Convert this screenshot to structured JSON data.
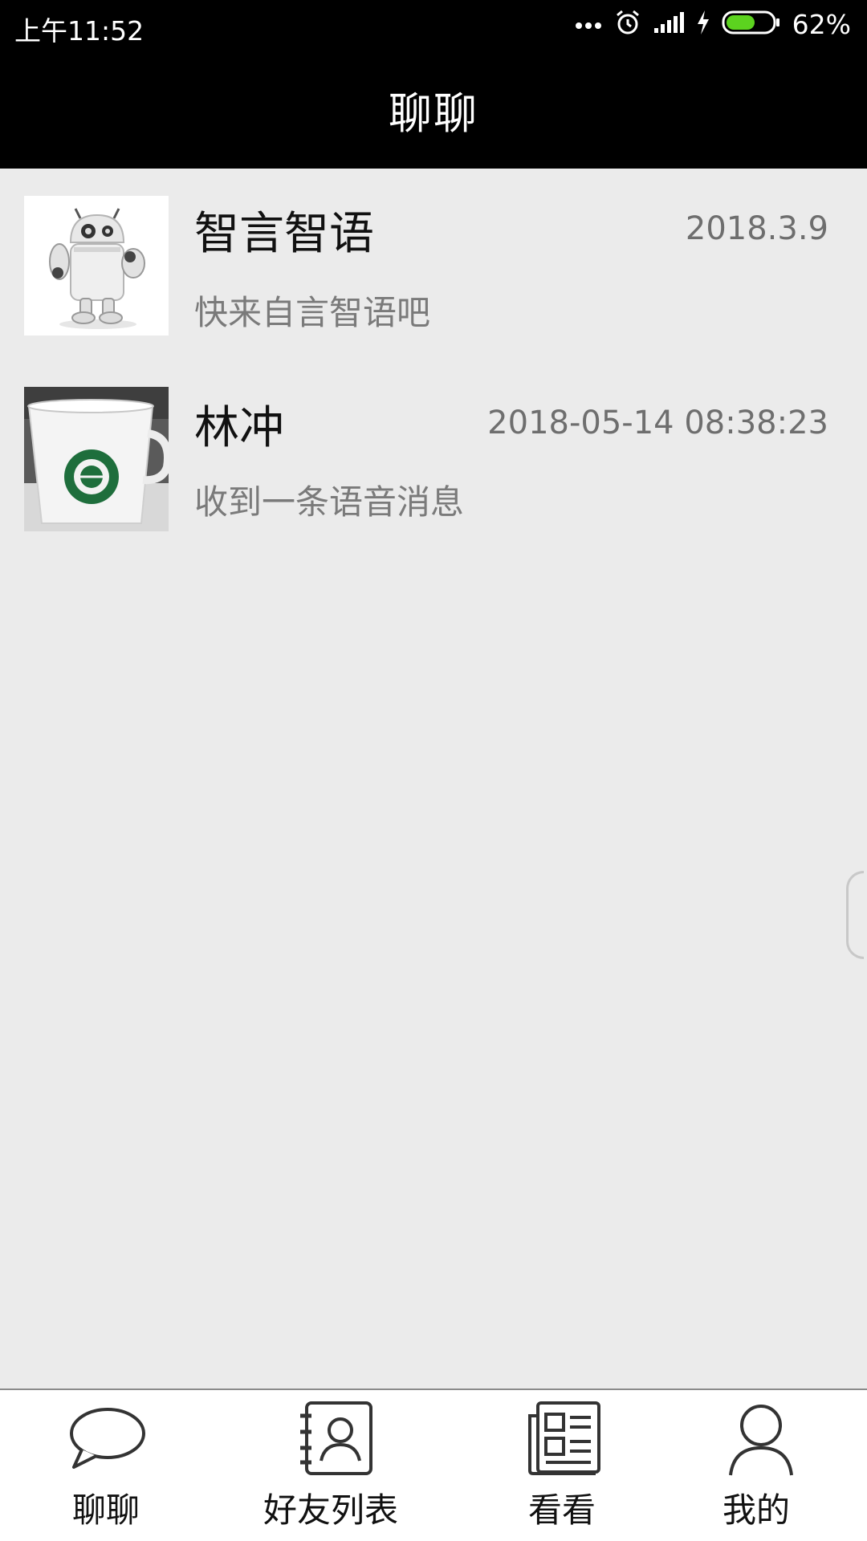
{
  "status_bar": {
    "time": "上午11:52",
    "battery_percent": "62%",
    "battery_level": 0.62,
    "icons": [
      "more-dots-icon",
      "alarm-icon",
      "signal-icon",
      "charging-icon",
      "battery-icon"
    ]
  },
  "header": {
    "title": "聊聊"
  },
  "chats": [
    {
      "name": "智言智语",
      "time": "2018.3.9",
      "preview": "快来自言智语吧",
      "avatar": "robot-avatar"
    },
    {
      "name": "林冲",
      "time": "2018-05-14 08:38:23",
      "preview": "收到一条语音消息",
      "avatar": "cup-avatar"
    }
  ],
  "bottom_nav": {
    "items": [
      {
        "label": "聊聊",
        "icon": "chat-bubble-icon"
      },
      {
        "label": "好友列表",
        "icon": "contacts-book-icon"
      },
      {
        "label": "看看",
        "icon": "news-icon"
      },
      {
        "label": "我的",
        "icon": "person-icon"
      }
    ]
  },
  "colors": {
    "accent_battery": "#5cd31f",
    "background": "#ebebeb",
    "header": "#000000"
  }
}
